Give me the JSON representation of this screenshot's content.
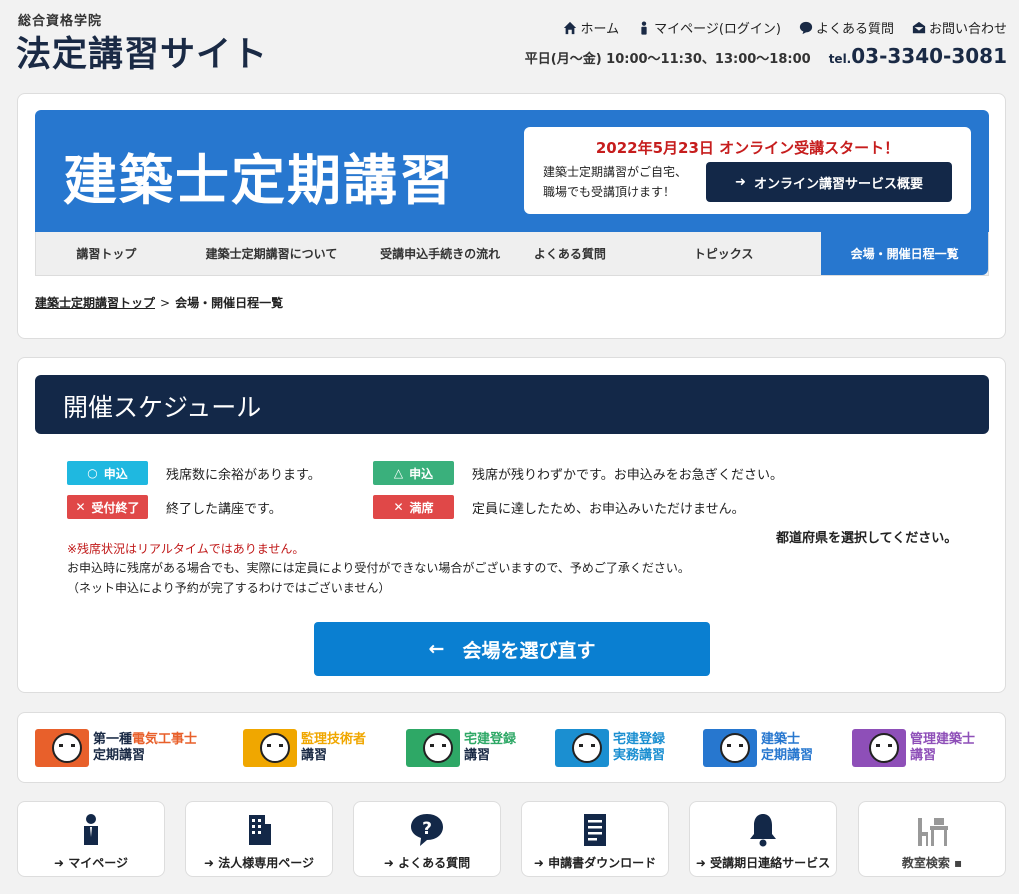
{
  "header": {
    "logo_sub": "総合資格学院",
    "logo_main": "法定講習サイト",
    "nav": [
      {
        "label": "ホーム",
        "icon": "home-icon"
      },
      {
        "label": "マイページ(ログイン)",
        "icon": "person-icon"
      },
      {
        "label": "よくある質問",
        "icon": "question-icon"
      },
      {
        "label": "お問い合わせ",
        "icon": "envelope-icon"
      }
    ],
    "hours": "平日(月～金) 10:00～11:30、13:00～18:00",
    "tel_prefix": "tel.",
    "tel_number": "03-3340-3081"
  },
  "hero": {
    "title": "建築士定期講習",
    "announce": "2022年5月23日 オンライン受講スタート！",
    "text_line1": "建築士定期講習がご自宅、",
    "text_line2": "職場でも受講頂けます！",
    "button_label": "オンライン講習サービス概要"
  },
  "tabs": [
    {
      "label": "講習トップ",
      "active": false
    },
    {
      "label": "建築士定期講習について",
      "active": false
    },
    {
      "label": "受講申込手続きの流れ",
      "active": false
    },
    {
      "label": "よくある質問",
      "active": false
    },
    {
      "label": "トピックス",
      "active": false
    },
    {
      "label": "会場・開催日程一覧",
      "active": true
    }
  ],
  "breadcrumb": {
    "link": "建築士定期講習トップ",
    "separator": ">",
    "current": "会場・開催日程一覧"
  },
  "schedule": {
    "title": "開催スケジュール",
    "legend": [
      {
        "badge": "申込",
        "symbol": "○",
        "text": "残席数に余裕があります。",
        "color": "#1fb8e0"
      },
      {
        "badge": "申込",
        "symbol": "△",
        "text": "残席が残りわずかです。お申込みをお急ぎください。",
        "color": "#3ab07c"
      },
      {
        "badge": "受付終了",
        "symbol": "✕",
        "text": "終了した講座です。",
        "color": "#e04848"
      },
      {
        "badge": "満席",
        "symbol": "✕",
        "text": "定員に達したため、お申込みいただけません。",
        "color": "#e04848"
      }
    ],
    "note_red": "※残席状況はリアルタイムではありません。",
    "note_1": "お申込時に残席がある場合でも、実際には定員により受付ができない場合がございますので、予めご了承ください。",
    "note_2": "（ネット申込により予約が完了するわけではございません）",
    "prefecture_prompt": "都道府県を選択してください。",
    "reselect_button": "会場を選び直す"
  },
  "courses": [
    {
      "line1_a": "第一種",
      "line1_b": "電気工事士",
      "line2": "定期講習",
      "color": "#e8602b",
      "color_b": "#e8602b"
    },
    {
      "line1_a": "監理技術者",
      "line1_b": "",
      "line2": "講習",
      "color": "#f0a700",
      "color_b": "#f0a700"
    },
    {
      "line1_a": "宅建登録",
      "line1_b": "",
      "line2": "講習",
      "color": "#2ea866",
      "color_b": "#2ea866"
    },
    {
      "line1_a": "宅建登録",
      "line1_b": "",
      "line2": "実務講習",
      "color": "#1b8fd1",
      "color_b": "#1b8fd1"
    },
    {
      "line1_a": "建築士",
      "line1_b": "",
      "line2": "定期講習",
      "color": "#2777cf",
      "color_b": "#2777cf"
    },
    {
      "line1_a": "管理建築士",
      "line1_b": "",
      "line2": "講習",
      "color": "#8e4fb8",
      "color_b": "#8e4fb8"
    }
  ],
  "bottom_buttons": [
    {
      "label": "マイページ",
      "icon": "person-icon"
    },
    {
      "label": "法人様専用ページ",
      "icon": "building-icon"
    },
    {
      "label": "よくある質問",
      "icon": "question-bubble-icon"
    },
    {
      "label": "申講書ダウンロード",
      "icon": "document-icon"
    },
    {
      "label": "受講期日連絡サービス",
      "icon": "bell-icon"
    },
    {
      "label": "教室検索",
      "icon": "desk-icon"
    }
  ]
}
